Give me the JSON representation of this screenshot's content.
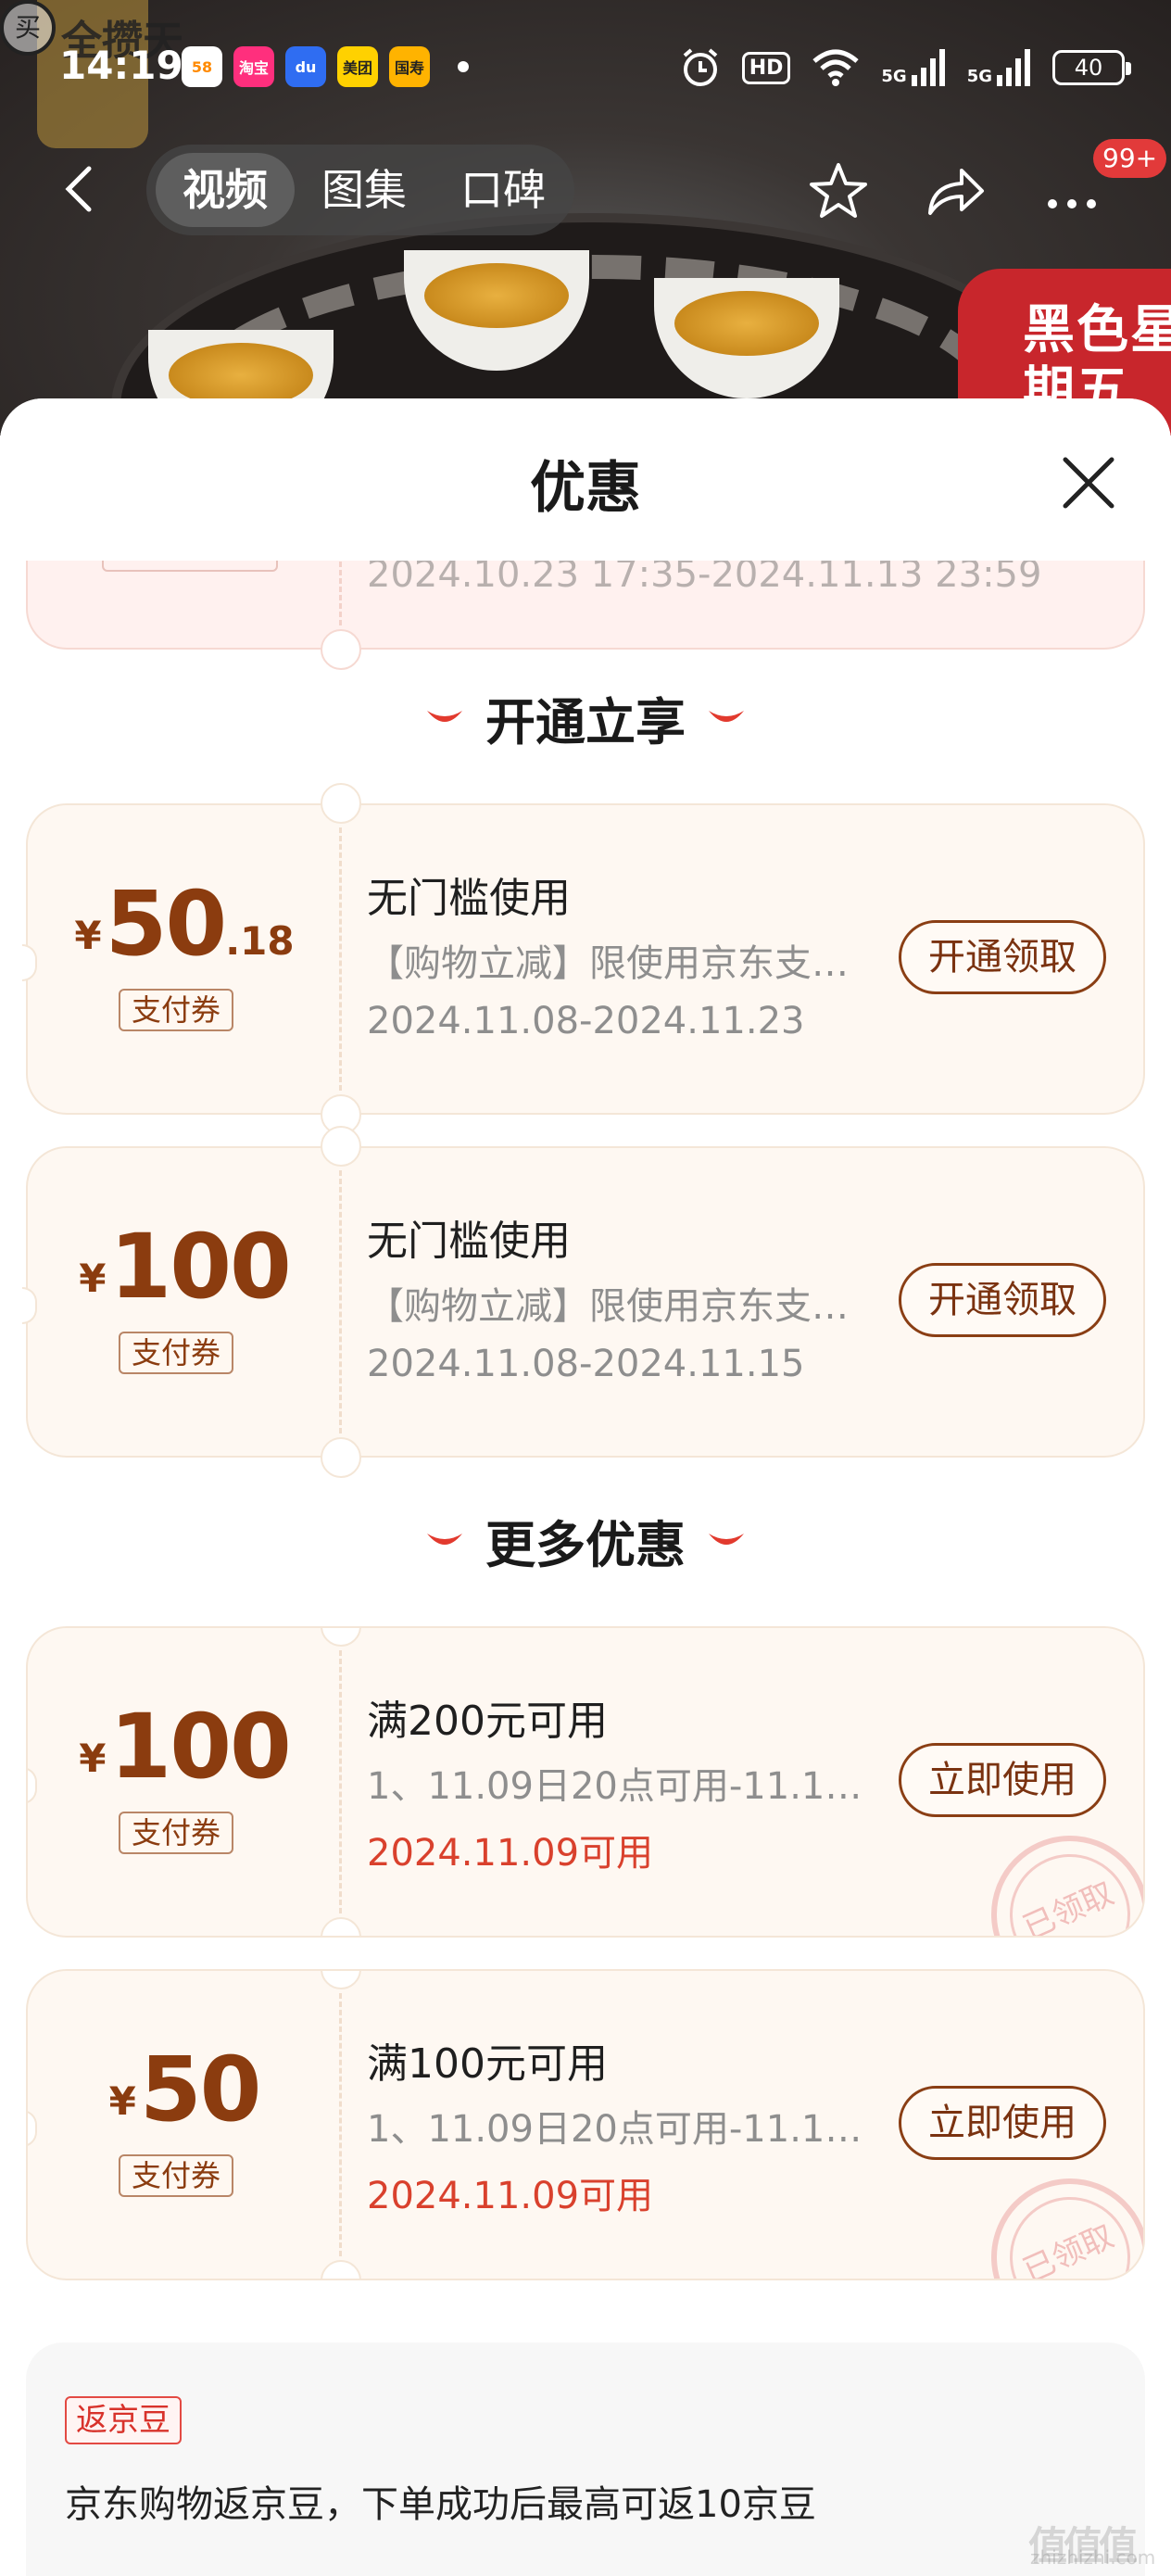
{
  "status_bar": {
    "time": "14:19",
    "apps": [
      {
        "name": "58",
        "color": "#ff8a00"
      },
      {
        "name": "淘宝",
        "color": "#ff2f7d"
      },
      {
        "name": "du",
        "color": "#2f6df2"
      },
      {
        "name": "美团",
        "color": "#ffd100"
      },
      {
        "name": "国寿",
        "color": "#ffb300"
      }
    ],
    "hd": "HD",
    "sim1": "5G",
    "sim2": "5G",
    "battery": "40"
  },
  "nav": {
    "tabs": [
      "视频",
      "图集",
      "口碑"
    ],
    "active_tab": 0,
    "badge": "99+"
  },
  "background": {
    "brand_stamp": "买",
    "brand_text": "全攒天",
    "red_badge": "黑色星期五"
  },
  "sheet": {
    "title": "优惠",
    "top_partial": {
      "date": "2024.10.23 17:35-2024.11.13 23:59"
    },
    "section1": "开通立享",
    "section2": "更多优惠",
    "coupons": [
      {
        "yen": "¥",
        "amount": "50",
        "decimal": ".18",
        "type": "支付券",
        "title": "无门槛使用",
        "desc": "【购物立减】限使用京东支付…",
        "date": "2024.11.08-2024.11.23",
        "button": "开通领取"
      },
      {
        "yen": "¥",
        "amount": "100",
        "decimal": "",
        "type": "支付券",
        "title": "无门槛使用",
        "desc": "【购物立减】限使用京东支付…",
        "date": "2024.11.08-2024.11.15",
        "button": "开通领取"
      },
      {
        "yen": "¥",
        "amount": "100",
        "decimal": "",
        "type": "支付券",
        "title": "满200元可用",
        "desc": "1、11.09日20点可用-11.11…",
        "date": "2024.11.09可用",
        "button": "立即使用",
        "stamp": "已领取"
      },
      {
        "yen": "¥",
        "amount": "50",
        "decimal": "",
        "type": "支付券",
        "title": "满100元可用",
        "desc": "1、11.09日20点可用-11.11…",
        "date": "2024.11.09可用",
        "button": "立即使用",
        "stamp": "已领取"
      }
    ],
    "jingdou": {
      "tag": "返京豆",
      "text": "京东购物返京豆，下单成功后最高可返10京豆"
    }
  },
  "watermark": {
    "main": "值值值",
    "sub": "zhizhizhi.com"
  },
  "colors": {
    "accent_brown": "#8b3c0f",
    "red": "#d9412d",
    "card_bg": "#fef8f2"
  }
}
